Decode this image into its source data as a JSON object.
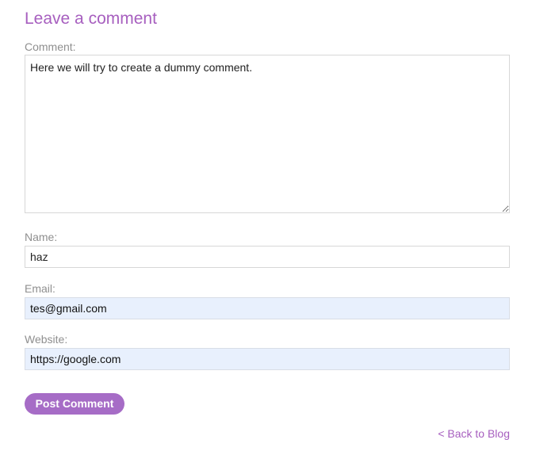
{
  "page": {
    "heading": "Leave a comment"
  },
  "form": {
    "comment": {
      "label": "Comment:",
      "value": "Here we will try to create a dummy comment."
    },
    "name": {
      "label": "Name:",
      "value": "haz"
    },
    "email": {
      "label": "Email:",
      "value": "tes@gmail.com"
    },
    "website": {
      "label": "Website:",
      "value": "https://google.com"
    },
    "submit_label": "Post Comment"
  },
  "footer": {
    "back_link": "< Back to Blog"
  },
  "colors": {
    "accent": "#a75fbf",
    "button": "#a66cc6",
    "autofill_background": "#e8f0fd",
    "label": "#8f8f8f"
  }
}
